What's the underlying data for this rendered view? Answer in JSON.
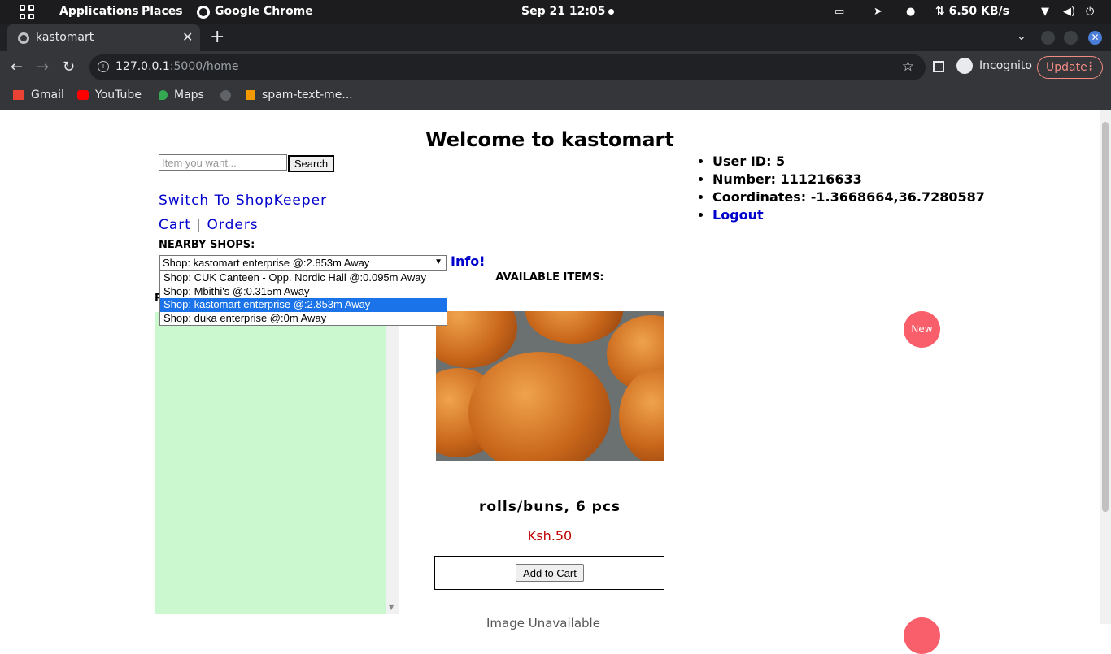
{
  "system_bar": {
    "applications": "Applications",
    "places": "Places",
    "active_app": "Google Chrome",
    "clock": "Sep 21  12:05",
    "net_speed": "⇅ 6.50 KB/s"
  },
  "browser": {
    "tab_title": "kastomart",
    "url_host": "127.0.0.1",
    "url_rest": ":5000/home",
    "incognito_label": "Incognito",
    "update_label": "Update",
    "bookmarks": [
      {
        "label": "Gmail",
        "color": "#ea4335"
      },
      {
        "label": "YouTube",
        "color": "#ff0000"
      },
      {
        "label": "Maps",
        "color": "#34a853"
      },
      {
        "label": "",
        "color": "#5f6368"
      },
      {
        "label": "spam-text-me...",
        "color": "#f29900"
      }
    ]
  },
  "page": {
    "heading": "Welcome to kastomart",
    "search_placeholder": "Item you want...",
    "search_button": "Search",
    "switch_link": "Switch To ShopKeeper",
    "cart_link": "Cart",
    "separator": "|",
    "orders_link": "Orders",
    "nearby_label": "NEARBY SHOPS:",
    "selected_shop": "Shop: kastomart enterprise @:2.853m Away",
    "info_link": "Info!",
    "shop_options": [
      "Shop: CUK Canteen - Opp. Nordic Hall @:0.095m Away",
      "Shop: Mbithi's @:0.315m Away",
      "Shop: kastomart enterprise @:2.853m Away",
      "Shop: duka enterprise @:0m Away"
    ],
    "panel_label_partial": "R",
    "user": {
      "id": "User ID: 5",
      "number": "Number: 111216633",
      "coordinates": "Coordinates: -1.3668664,36.7280587",
      "logout": "Logout"
    },
    "available_label": "AVAILABLE ITEMS:",
    "items": [
      {
        "name": "rolls/buns, 6 pcs",
        "price": "Ksh.50",
        "add_button": "Add to Cart",
        "badge": "New"
      }
    ],
    "next_item_alt": "Image Unavailable"
  }
}
